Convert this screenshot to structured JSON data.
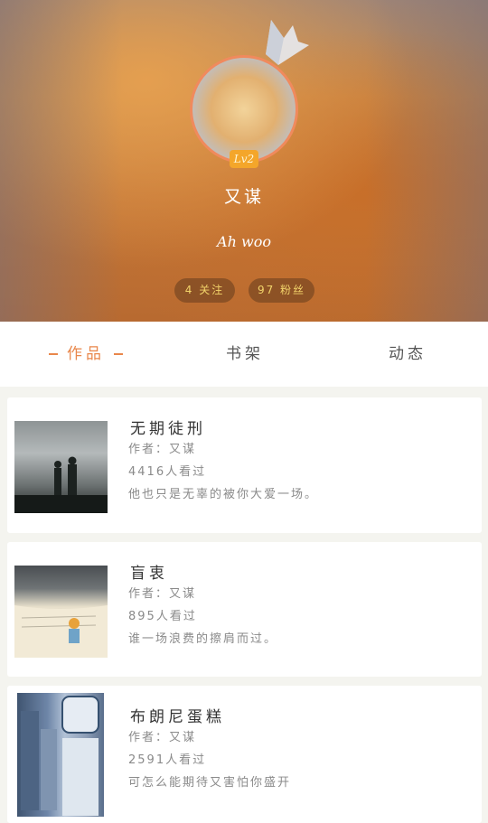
{
  "profile": {
    "username": "又谋",
    "level": "Lv2",
    "signature": "Ah woo",
    "following": "4 关注",
    "fans": "97 粉丝"
  },
  "tabs": [
    {
      "label": "作品",
      "active": true
    },
    {
      "label": "书架",
      "active": false
    },
    {
      "label": "动态",
      "active": false
    }
  ],
  "works": [
    {
      "title": "无期徒刑",
      "author": "作者：又谋",
      "views": "4416人看过",
      "desc": "他也只是无辜的被你大爱一场。"
    },
    {
      "title": "盲衷",
      "author": "作者：又谋",
      "views": "895人看过",
      "desc": "谁一场浪费的擦肩而过。"
    },
    {
      "title": "布朗尼蛋糕",
      "author": "作者：又谋",
      "views": "2591人看过",
      "desc": "可怎么能期待又害怕你盛开"
    }
  ],
  "colors": {
    "accent": "#e9874b",
    "badge": "#f4a62a",
    "pill_text": "#f2d36a"
  }
}
